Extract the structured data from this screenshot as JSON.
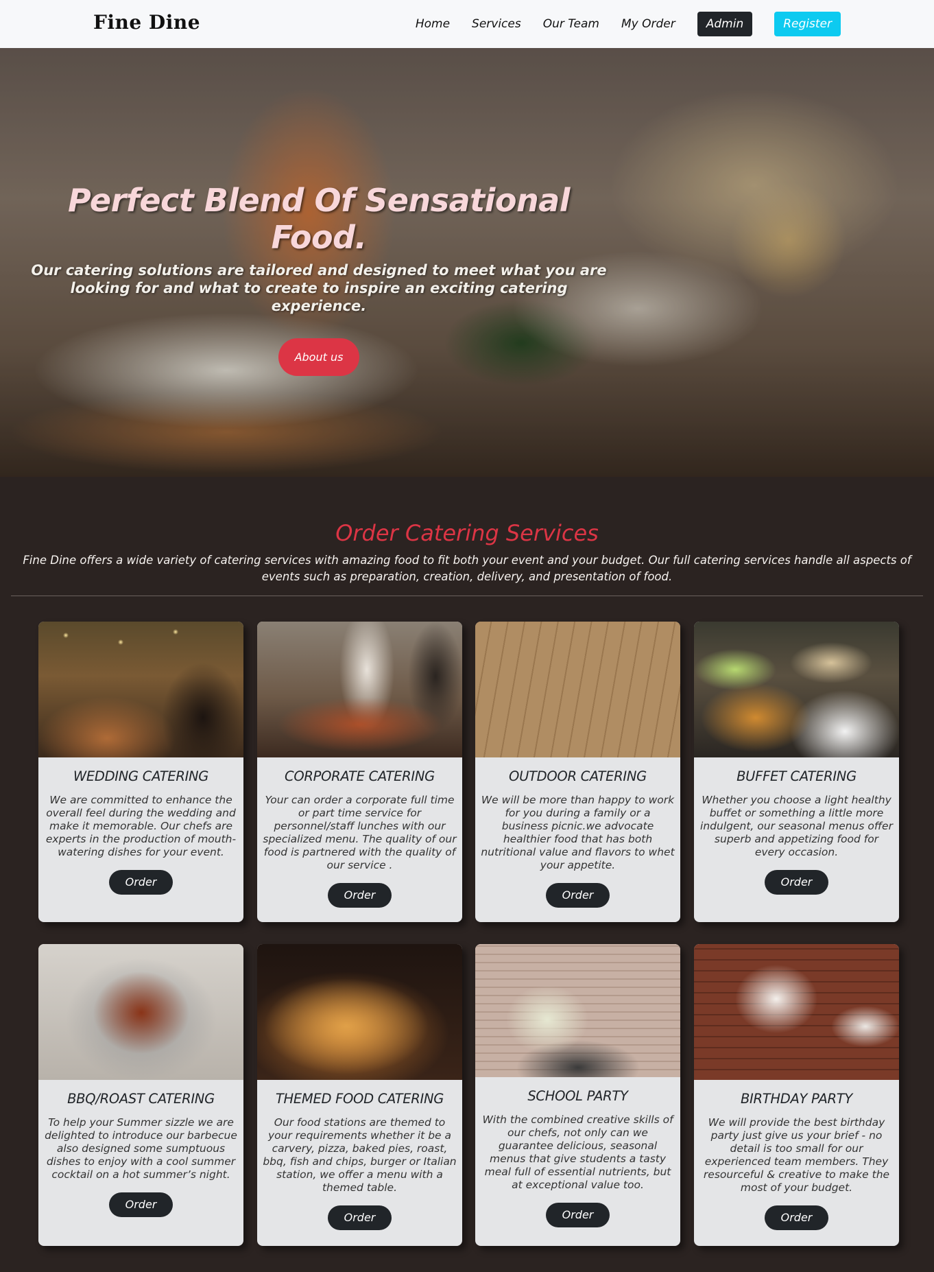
{
  "brand": "Fine Dine",
  "nav": {
    "home": "Home",
    "services": "Services",
    "team": "Our Team",
    "order": "My Order",
    "admin": "Admin",
    "register": "Register"
  },
  "hero": {
    "title": "Perfect Blend Of Sensational Food.",
    "subtitle": "Our catering solutions are tailored and designed to meet what you are looking for and what to create to inspire an exciting catering experience.",
    "button": "About us"
  },
  "section": {
    "title": "Order Catering Services",
    "description": "Fine Dine offers a wide variety of catering services with amazing food to fit both your event and your budget. Our full catering services handle all aspects of events such as preparation, creation, delivery, and presentation of food."
  },
  "cards": [
    {
      "title": "WEDDING CATERING",
      "text": "We are committed to enhance the overall feel during the wedding and make it memorable. Our chefs are experts in the production of mouth-watering dishes for your event.",
      "button": "Order"
    },
    {
      "title": "CORPORATE CATERING",
      "text": "Your can order a corporate full time or part time service for personnel/staff lunches with our specialized menu. The quality of our food is partnered with the quality of our service .",
      "button": "Order"
    },
    {
      "title": "OUTDOOR CATERING",
      "text": "We will be more than happy to work for you during a family or a business picnic.we advocate healthier food that has both nutritional value and flavors to whet your appetite.",
      "button": "Order"
    },
    {
      "title": "BUFFET CATERING",
      "text": "Whether you choose a light healthy buffet or something a little more indulgent, our seasonal menus offer superb and appetizing food for every occasion.",
      "button": "Order"
    },
    {
      "title": "BBQ/ROAST CATERING",
      "text": "To help your Summer sizzle we are delighted to introduce our barbecue also designed some sumptuous dishes to enjoy with a cool summer cocktail on a hot summer’s night.",
      "button": "Order"
    },
    {
      "title": "THEMED FOOD CATERING",
      "text": "Our food stations are themed to your requirements whether it be a carvery, pizza, baked pies, roast, bbq, fish and chips, burger or Italian station, we offer a menu with a themed table.",
      "button": "Order"
    },
    {
      "title": "SCHOOL PARTY",
      "text": "With the combined creative skills of our chefs, not only can we guarantee delicious, seasonal menus that give students a tasty meal full of essential nutrients, but at exceptional value too.",
      "button": "Order"
    },
    {
      "title": "BIRTHDAY PARTY",
      "text": "We will provide the best birthday party just give us your brief - no detail is too small for our experienced team members. They resourceful & creative to make the most of your budget.",
      "button": "Order"
    }
  ]
}
